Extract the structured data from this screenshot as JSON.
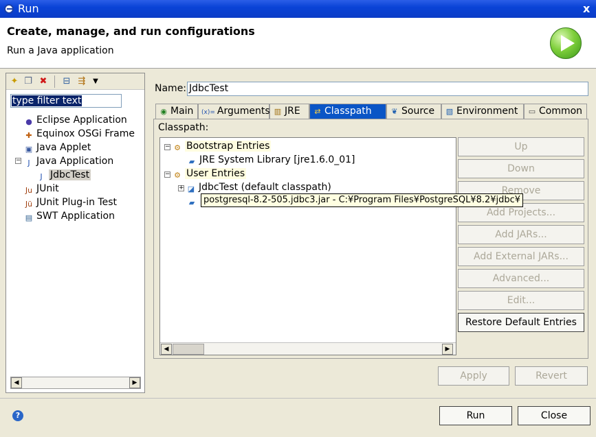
{
  "window": {
    "title": "Run",
    "close_glyph": "x"
  },
  "header": {
    "title": "Create, manage, and run configurations",
    "subtitle": "Run a Java application",
    "icon": "run-icon"
  },
  "left": {
    "filter_text": "type filter text",
    "tree": [
      {
        "label": "Eclipse Application",
        "icon": "eclipse-icon",
        "indent": 1
      },
      {
        "label": "Equinox OSGi Frame",
        "icon": "osgi-icon",
        "indent": 1
      },
      {
        "label": "Java Applet",
        "icon": "applet-icon",
        "indent": 1
      },
      {
        "label": "Java Application",
        "icon": "java-app-icon",
        "indent": 1,
        "expanded": true
      },
      {
        "label": "JdbcTest",
        "icon": "java-config-icon",
        "indent": 2,
        "selected": true
      },
      {
        "label": "JUnit",
        "icon": "junit-icon",
        "indent": 1
      },
      {
        "label": "JUnit Plug-in Test",
        "icon": "junit-plugin-icon",
        "indent": 1
      },
      {
        "label": "SWT Application",
        "icon": "swt-icon",
        "indent": 1
      }
    ]
  },
  "right": {
    "name_label": "Name:",
    "name_value": "JdbcTest",
    "tabs": [
      {
        "label": "Main",
        "icon": "main-tab-icon"
      },
      {
        "label": "Arguments",
        "icon": "arguments-tab-icon"
      },
      {
        "label": "JRE",
        "icon": "jre-tab-icon"
      },
      {
        "label": "Classpath",
        "icon": "classpath-tab-icon",
        "active": true
      },
      {
        "label": "Source",
        "icon": "source-tab-icon"
      },
      {
        "label": "Environment",
        "icon": "environment-tab-icon"
      },
      {
        "label": "Common",
        "icon": "common-tab-icon"
      }
    ],
    "classpath_label": "Classpath:",
    "classpath_tree": [
      {
        "label": "Bootstrap Entries",
        "level": 0,
        "expander": "−",
        "highlight": true
      },
      {
        "label": "JRE System Library [jre1.6.0_01]",
        "level": 1
      },
      {
        "label": "User Entries",
        "level": 0,
        "expander": "−",
        "highlight": true
      },
      {
        "label": "JdbcTest (default classpath)",
        "level": 1,
        "expander": "+"
      },
      {
        "label": "",
        "level": 1
      }
    ],
    "tooltip": "postgresql-8.2-505.jdbc3.jar - C:¥Program Files¥PostgreSQL¥8.2¥jdbc¥",
    "side_buttons": [
      {
        "label": "Up",
        "enabled": false
      },
      {
        "label": "Down",
        "enabled": false
      },
      {
        "label": "Remove",
        "enabled": false
      },
      {
        "label": "Add Projects...",
        "enabled": false
      },
      {
        "label": "Add JARs...",
        "enabled": false
      },
      {
        "label": "Add External JARs...",
        "enabled": false
      },
      {
        "label": "Advanced...",
        "enabled": false
      },
      {
        "label": "Edit...",
        "enabled": false
      },
      {
        "label": "Restore Default Entries",
        "enabled": true
      }
    ],
    "apply_label": "Apply",
    "revert_label": "Revert"
  },
  "footer": {
    "run_label": "Run",
    "close_label": "Close",
    "help_glyph": "?"
  }
}
